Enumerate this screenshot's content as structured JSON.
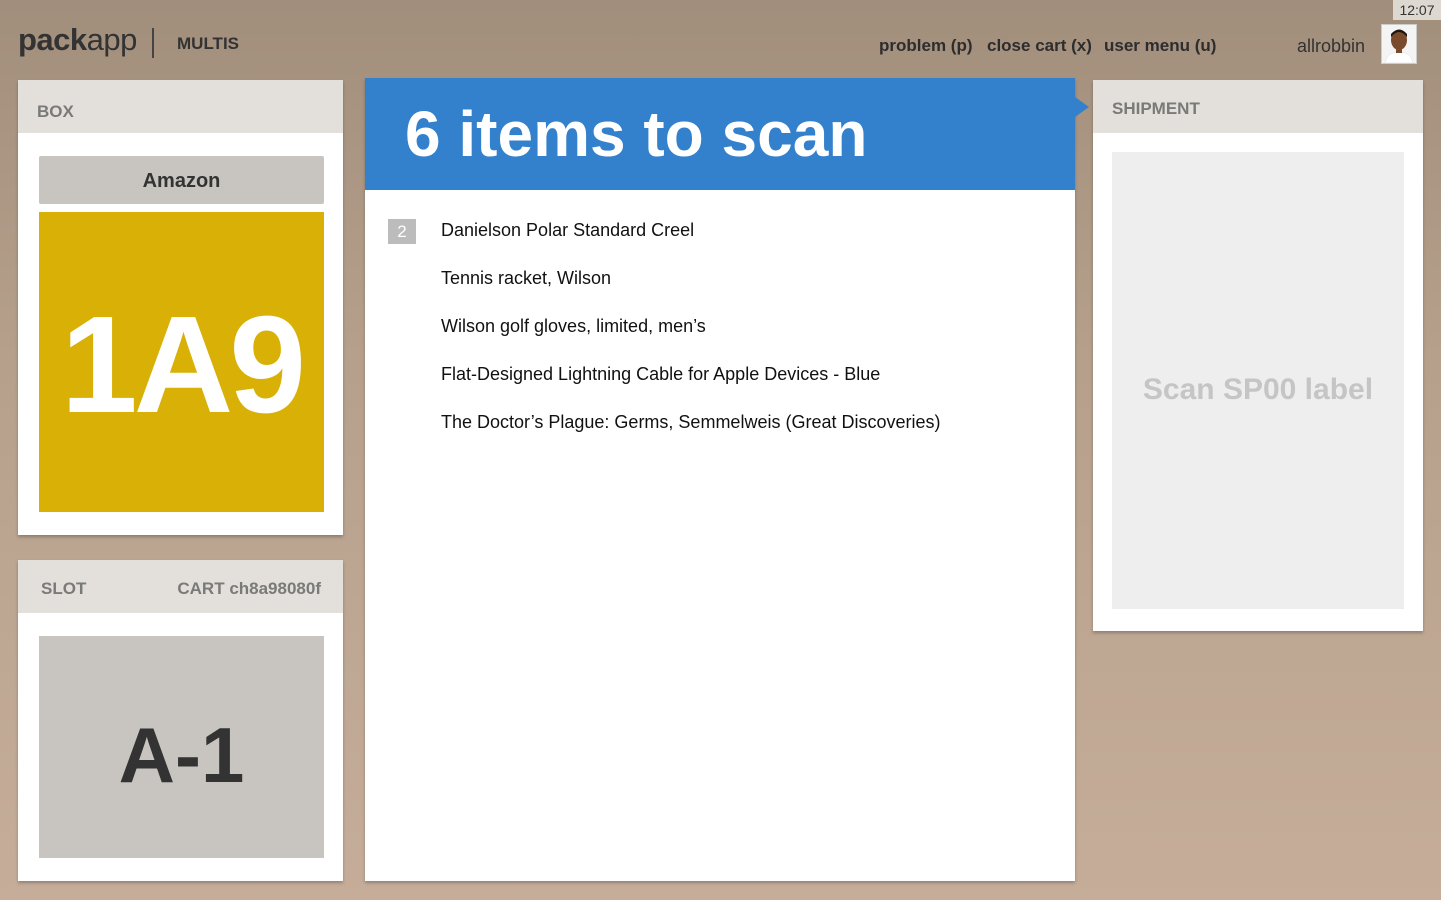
{
  "clock": "12:07",
  "header": {
    "logo_bold": "pack",
    "logo_light": "app",
    "mode": "MULTIS",
    "nav": {
      "problem": "problem (p)",
      "close_cart": "close cart (x)",
      "user_menu": "user menu (u)"
    },
    "username": "allrobbin",
    "avatar_icon": "user-avatar-icon"
  },
  "box_panel": {
    "title": "BOX",
    "carrier": "Amazon",
    "code": "1A9",
    "code_color": "#d8b006"
  },
  "slot_panel": {
    "title": "SLOT",
    "cart": "CART ch8a98080f",
    "code": "A-1"
  },
  "items_panel": {
    "heading": "6 items to scan",
    "accent": "#3381cc",
    "items": [
      {
        "qty": "2",
        "name": "Danielson Polar Standard Creel"
      },
      {
        "qty": "",
        "name": "Tennis racket, Wilson"
      },
      {
        "qty": "",
        "name": "Wilson golf gloves, limited, men’s"
      },
      {
        "qty": "",
        "name": "Flat-Designed Lightning Cable for Apple Devices - Blue"
      },
      {
        "qty": "",
        "name": "The Doctor’s Plague: Germs, Semmelweis (Great Discoveries)"
      }
    ]
  },
  "shipment_panel": {
    "title": "SHIPMENT",
    "prompt": "Scan SP00 label"
  }
}
